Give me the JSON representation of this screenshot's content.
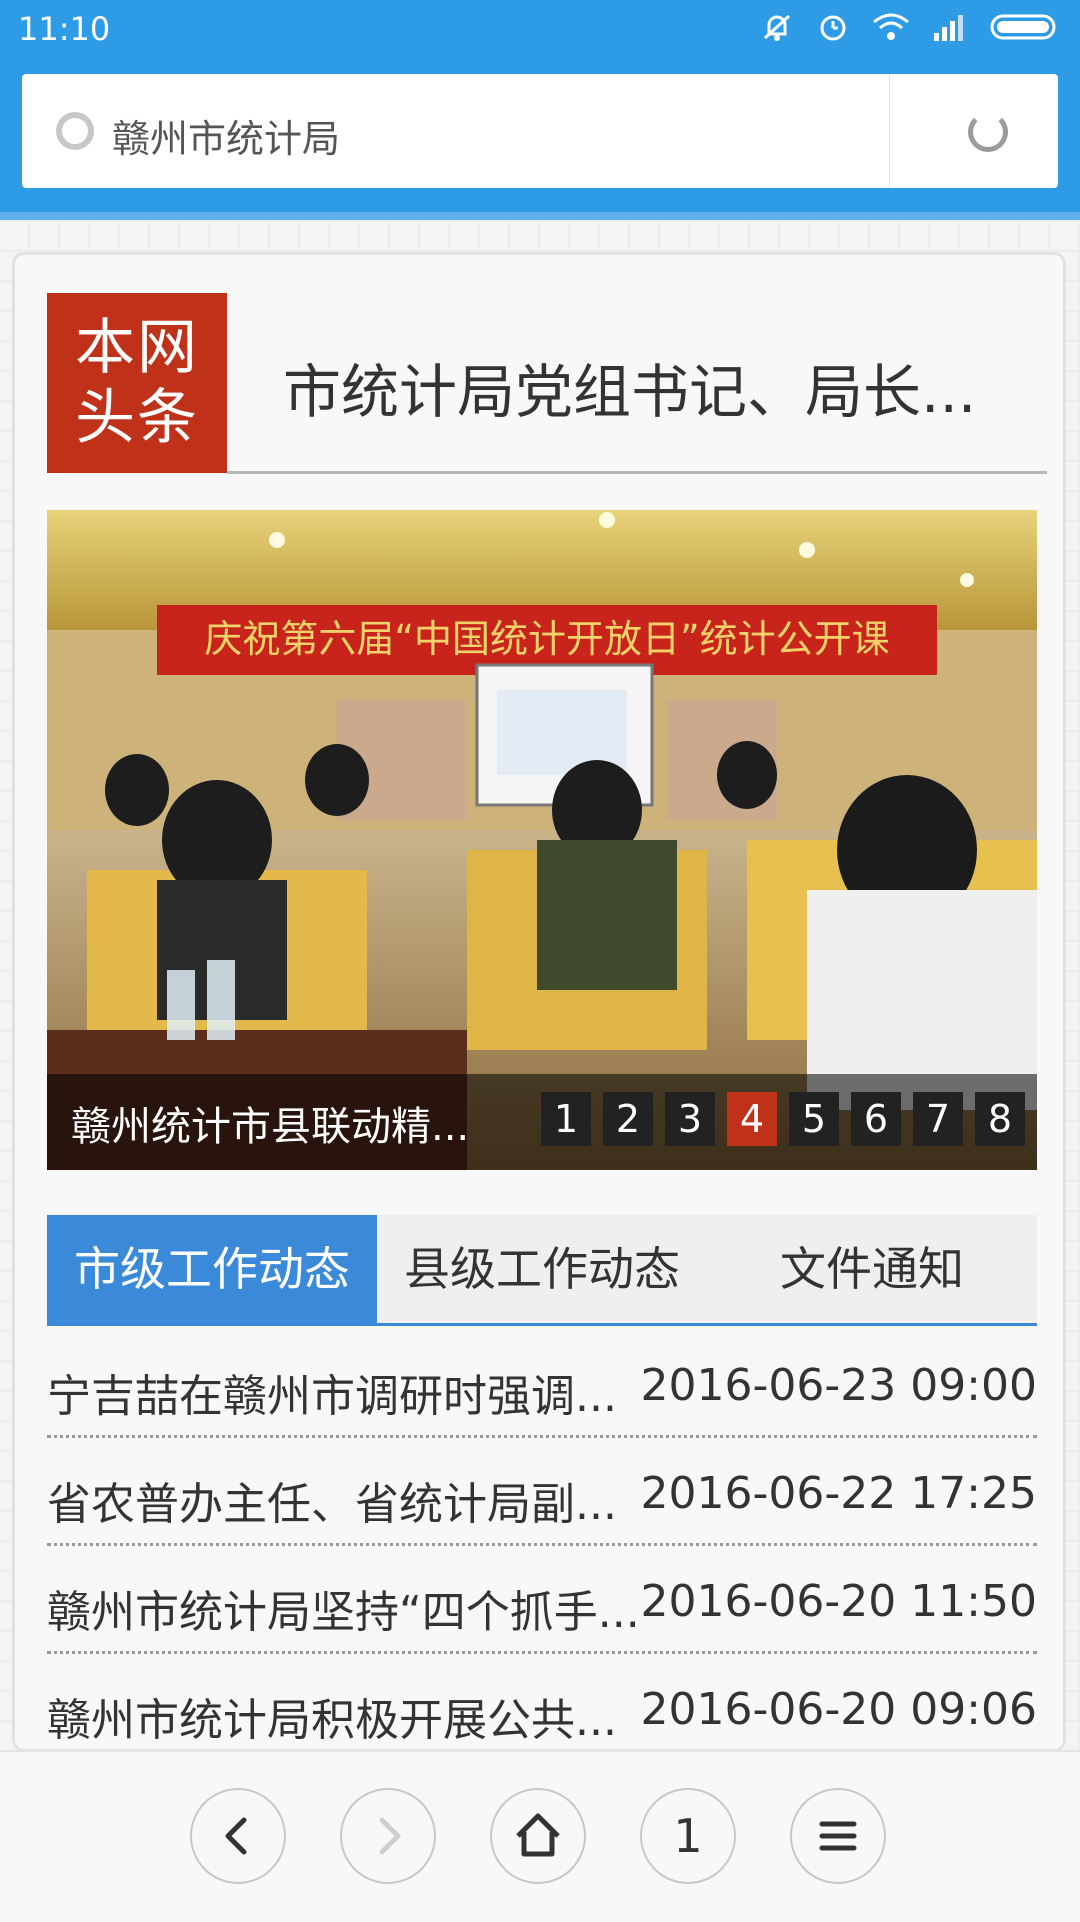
{
  "status_bar": {
    "time": "11:10",
    "icons": [
      "bell-mute-icon",
      "alarm-icon",
      "wifi-icon",
      "signal-icon",
      "battery-icon"
    ]
  },
  "browser": {
    "url_text": "赣州市统计局"
  },
  "headline": {
    "badge": "本网头条",
    "badge_line1": "本网",
    "badge_line2": "头条",
    "title": "市统计局党组书记、局长..."
  },
  "slideshow": {
    "banner_text": "庆祝第六届“中国统计开放日”统计公开课",
    "caption": "赣州统计市县联动精...",
    "pages": [
      "1",
      "2",
      "3",
      "4",
      "5",
      "6",
      "7",
      "8"
    ],
    "active_page": "4"
  },
  "tabs": [
    {
      "label": "市级工作动态",
      "active": true
    },
    {
      "label": "县级工作动态",
      "active": false
    },
    {
      "label": "文件通知",
      "active": false
    }
  ],
  "news": [
    {
      "title": "宁吉喆在赣州市调研时强调...",
      "date": "2016-06-23 09:00"
    },
    {
      "title": "省农普办主任、省统计局副...",
      "date": "2016-06-22 17:25"
    },
    {
      "title": "赣州市统计局坚持“四个抓手...",
      "date": "2016-06-20 11:50"
    },
    {
      "title": "赣州市统计局积极开展公共...",
      "date": "2016-06-20 09:06"
    }
  ],
  "bottom_nav": {
    "tab_count": "1"
  },
  "colors": {
    "accent_blue": "#2d9be6",
    "tab_blue": "#3b8ad9",
    "headline_red": "#c0311a"
  }
}
